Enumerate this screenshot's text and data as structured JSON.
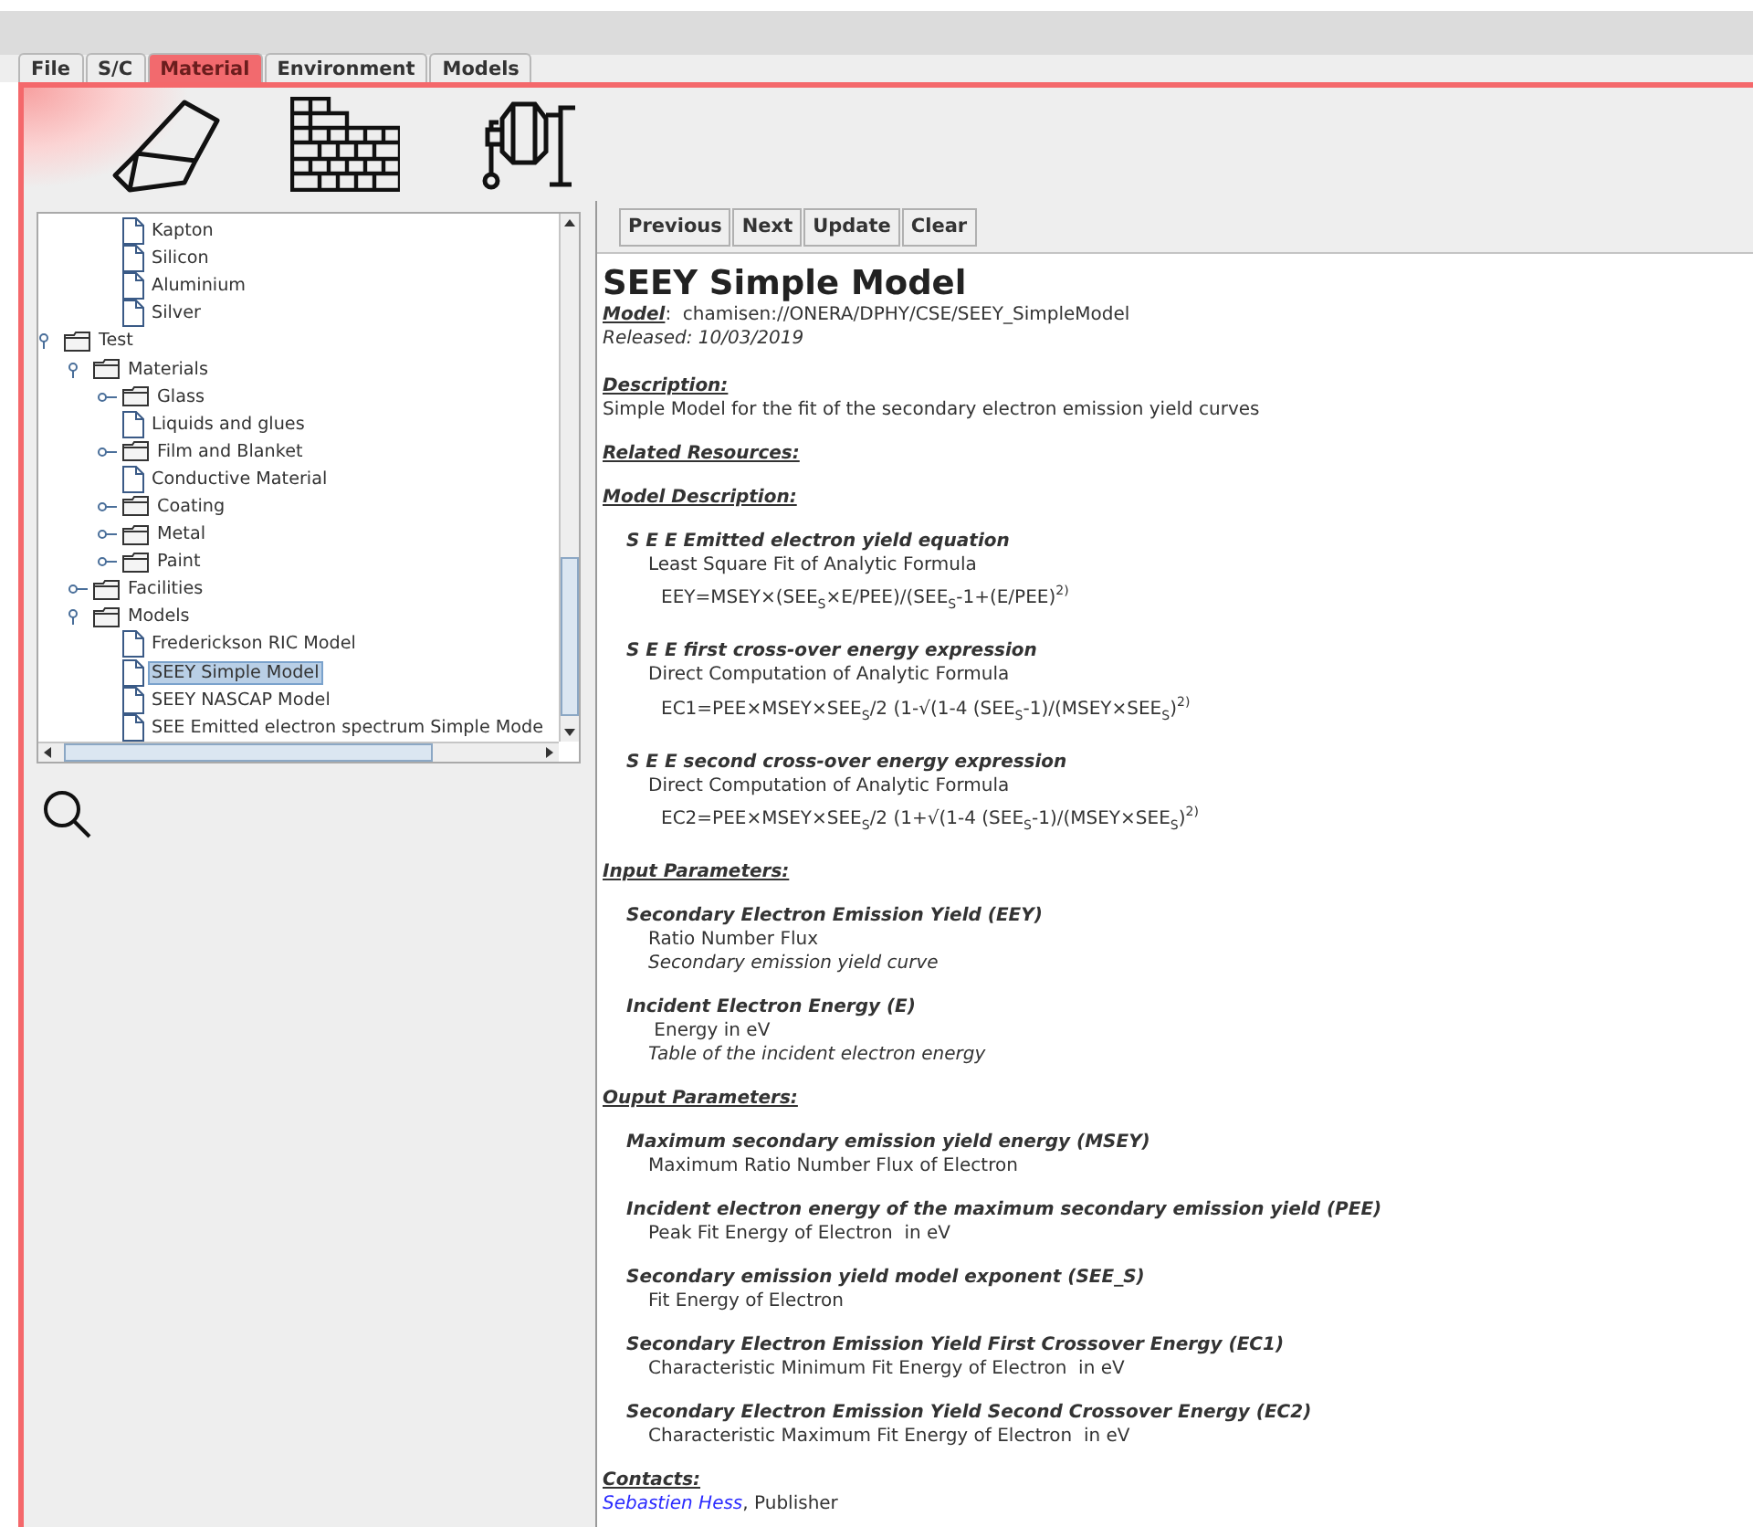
{
  "tabs": [
    {
      "label": "File",
      "selected": false
    },
    {
      "label": "S/C",
      "selected": false
    },
    {
      "label": "Material",
      "selected": true
    },
    {
      "label": "Environment",
      "selected": false
    },
    {
      "label": "Models",
      "selected": false
    }
  ],
  "tree": [
    {
      "children": [
        {
          "children": [
            {
              "kind": "document",
              "label": "Kapton",
              "selected": false
            },
            {
              "kind": "document",
              "label": "Silicon",
              "selected": false
            },
            {
              "kind": "document",
              "label": "Aluminium",
              "selected": false
            },
            {
              "kind": "document",
              "label": "Silver",
              "selected": false
            }
          ]
        }
      ]
    },
    {
      "kind": "folder",
      "label": "Test",
      "expanded": true,
      "selected": false,
      "children": [
        {
          "kind": "folder",
          "label": "Materials",
          "expanded": true,
          "selected": false,
          "children": [
            {
              "kind": "folder",
              "label": "Glass",
              "expanded": false,
              "selected": false
            },
            {
              "kind": "document",
              "label": "Liquids and glues",
              "selected": false
            },
            {
              "kind": "folder",
              "label": "Film and Blanket",
              "expanded": false,
              "selected": false
            },
            {
              "kind": "document",
              "label": "Conductive Material",
              "selected": false
            },
            {
              "kind": "folder",
              "label": "Coating",
              "expanded": false,
              "selected": false
            },
            {
              "kind": "folder",
              "label": "Metal",
              "expanded": false,
              "selected": false
            },
            {
              "kind": "folder",
              "label": "Paint",
              "expanded": false,
              "selected": false
            }
          ]
        },
        {
          "kind": "folder",
          "label": "Facilities",
          "expanded": false,
          "selected": false
        },
        {
          "kind": "folder",
          "label": "Models",
          "expanded": true,
          "selected": false,
          "children": [
            {
              "kind": "document",
              "label": "Frederickson RIC Model",
              "selected": false
            },
            {
              "kind": "document",
              "label": "SEEY Simple Model",
              "selected": true
            },
            {
              "kind": "document",
              "label": "SEEY NASCAP Model",
              "selected": false
            },
            {
              "kind": "document",
              "label": "SEE Emitted electron spectrum Simple Mode",
              "selected": false
            }
          ]
        }
      ]
    }
  ],
  "toolbar": [
    "Previous",
    "Next",
    "Update",
    "Clear"
  ],
  "document": {
    "title": "SEEY Simple Model",
    "model_label": "Model",
    "model_value": ":  chamisen://ONERA/DPHY/CSE/SEEY_SimpleModel",
    "released": "Released: 10/03/2019",
    "sections": [
      {
        "kind": "text",
        "heading": "Description:",
        "text": "Simple Model for the fit of the secondary electron emission yield curves"
      },
      {
        "kind": "empty",
        "heading": "Related Resources:"
      },
      {
        "kind": "formulas",
        "heading": "Model Description:",
        "items": [
          {
            "title": "S E E  Emitted electron yield equation",
            "subtitle": "Least  Square  Fit of Analytic Formula",
            "formula": "EEY=MSEY×(SEE$_{S}$×E/PEE)/(SEE$_{S}$-1+(E/PEE)$^{2)}$"
          },
          {
            "title": "S E E first cross-over energy expression",
            "subtitle": "Direct  Computation of Analytic Formula",
            "formula": "EC1=PEE×MSEY×SEE$_{S}$/2 (1-√(1-4 (SEE$_{S}$-1)/(MSEY×SEE$_{S}$)$^{2)}$"
          },
          {
            "title": "S E E second cross-over energy expression",
            "subtitle": "Direct  Computation of Analytic Formula",
            "formula": "EC2=PEE×MSEY×SEE$_{S}$/2 (1+√(1-4 (SEE$_{S}$-1)/(MSEY×SEE$_{S}$)$^{2)}$"
          }
        ]
      },
      {
        "kind": "params",
        "heading": "Input Parameters:",
        "items": [
          {
            "name": "Secondary  Electron  Emission  Yield (EEY)",
            "unit": "Ratio Number Flux",
            "note": "Secondary emission yield curve"
          },
          {
            "name": "Incident  Electron  Energy (E)",
            "unit": " Energy in eV",
            "note": "Table of the incident electron energy"
          }
        ]
      },
      {
        "kind": "params",
        "heading": "Ouput Parameters:",
        "items": [
          {
            "name": "Maximum secondary emission yield energy (MSEY)",
            "unit": "Maximum Ratio Number Flux of Electron"
          },
          {
            "name": "Incident electron energy of the maximum secondary emission yield (PEE)",
            "unit": "Peak Fit Energy of Electron  in eV"
          },
          {
            "name": "Secondary emission yield model exponent (SEE_S)",
            "unit": "Fit Energy of Electron"
          },
          {
            "name": "Secondary  Electron  Emission  Yield  First  Crossover  Energy (EC1)",
            "unit": "Characteristic Minimum Fit Energy of Electron  in eV"
          },
          {
            "name": "Secondary  Electron  Emission  Yield  Second  Crossover  Energy (EC2)",
            "unit": "Characteristic Maximum Fit Energy of Electron  in eV"
          }
        ]
      }
    ],
    "contacts": {
      "heading": "Contacts:",
      "name": "Sebastien Hess",
      "role": ", Publisher"
    }
  }
}
